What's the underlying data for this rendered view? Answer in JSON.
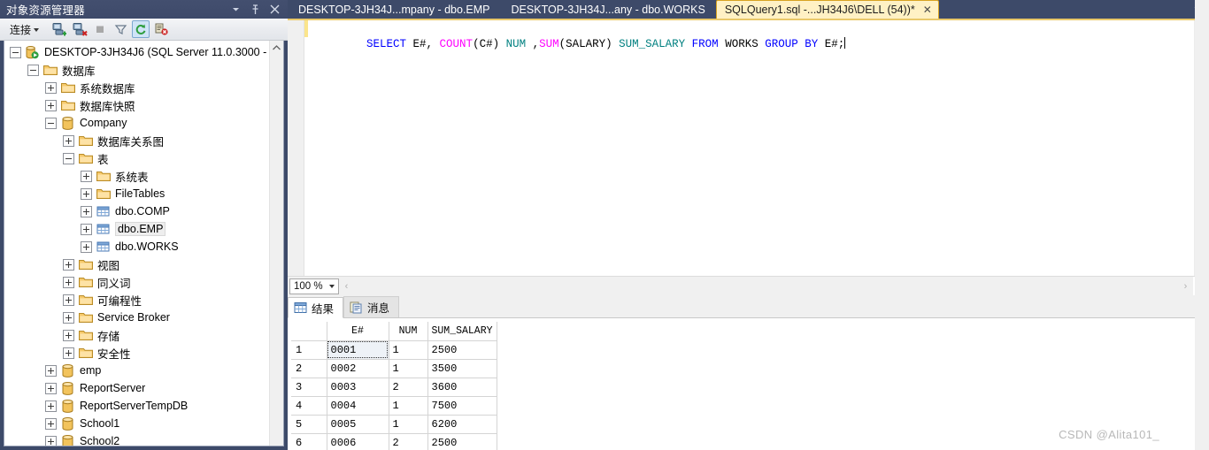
{
  "object_explorer": {
    "title": "对象资源管理器",
    "titlebar_icons": [
      "dropdown-icon",
      "pin-icon",
      "close-icon"
    ],
    "toolbar": {
      "connect_label": "连接",
      "buttons": [
        "connect-icon",
        "disconnect-icon",
        "stop-icon",
        "filter-icon",
        "refresh-icon",
        "script-stop-icon"
      ]
    },
    "tree": [
      {
        "indent": 0,
        "expander": "minus",
        "icon": "server-icon",
        "label": "DESKTOP-3JH34J6 (SQL Server 11.0.3000 -"
      },
      {
        "indent": 1,
        "expander": "minus",
        "icon": "folder-icon",
        "label": "数据库"
      },
      {
        "indent": 2,
        "expander": "plus",
        "icon": "folder-icon",
        "label": "系统数据库"
      },
      {
        "indent": 2,
        "expander": "plus",
        "icon": "folder-icon",
        "label": "数据库快照"
      },
      {
        "indent": 2,
        "expander": "minus",
        "icon": "database-icon",
        "label": "Company"
      },
      {
        "indent": 3,
        "expander": "plus",
        "icon": "folder-icon",
        "label": "数据库关系图"
      },
      {
        "indent": 3,
        "expander": "minus",
        "icon": "folder-icon",
        "label": "表"
      },
      {
        "indent": 4,
        "expander": "plus",
        "icon": "folder-icon",
        "label": "系统表"
      },
      {
        "indent": 4,
        "expander": "plus",
        "icon": "folder-icon",
        "label": "FileTables"
      },
      {
        "indent": 4,
        "expander": "plus",
        "icon": "table-icon",
        "label": "dbo.COMP"
      },
      {
        "indent": 4,
        "expander": "plus",
        "icon": "table-icon",
        "label": "dbo.EMP",
        "selected": true
      },
      {
        "indent": 4,
        "expander": "plus",
        "icon": "table-icon",
        "label": "dbo.WORKS"
      },
      {
        "indent": 3,
        "expander": "plus",
        "icon": "folder-icon",
        "label": "视图"
      },
      {
        "indent": 3,
        "expander": "plus",
        "icon": "folder-icon",
        "label": "同义词"
      },
      {
        "indent": 3,
        "expander": "plus",
        "icon": "folder-icon",
        "label": "可编程性"
      },
      {
        "indent": 3,
        "expander": "plus",
        "icon": "folder-icon",
        "label": "Service Broker"
      },
      {
        "indent": 3,
        "expander": "plus",
        "icon": "folder-icon",
        "label": "存储"
      },
      {
        "indent": 3,
        "expander": "plus",
        "icon": "folder-icon",
        "label": "安全性"
      },
      {
        "indent": 2,
        "expander": "plus",
        "icon": "database-icon",
        "label": "emp"
      },
      {
        "indent": 2,
        "expander": "plus",
        "icon": "database-icon",
        "label": "ReportServer"
      },
      {
        "indent": 2,
        "expander": "plus",
        "icon": "database-icon",
        "label": "ReportServerTempDB"
      },
      {
        "indent": 2,
        "expander": "plus",
        "icon": "database-icon",
        "label": "School1"
      },
      {
        "indent": 2,
        "expander": "plus",
        "icon": "database-icon",
        "label": "School2"
      }
    ]
  },
  "document_tabs": [
    {
      "label": "DESKTOP-3JH34J...mpany - dbo.EMP",
      "active": false
    },
    {
      "label": "DESKTOP-3JH34J...any - dbo.WORKS",
      "active": false
    },
    {
      "label": "SQLQuery1.sql -...JH34J6\\DELL (54))*",
      "active": true,
      "close_label": "✕"
    }
  ],
  "tab_overflow_icon": "chevron-down-icon",
  "editor": {
    "tokens": [
      {
        "text": "SELECT",
        "type": "keyword"
      },
      {
        "text": " E#, ",
        "type": "plain"
      },
      {
        "text": "COUNT",
        "type": "function"
      },
      {
        "text": "(C#) ",
        "type": "plain"
      },
      {
        "text": "NUM",
        "type": "alias"
      },
      {
        "text": " ,",
        "type": "plain"
      },
      {
        "text": "SUM",
        "type": "function"
      },
      {
        "text": "(SALARY) ",
        "type": "plain"
      },
      {
        "text": "SUM_SALARY",
        "type": "alias"
      },
      {
        "text": " ",
        "type": "plain"
      },
      {
        "text": "FROM",
        "type": "keyword"
      },
      {
        "text": " WORKS ",
        "type": "plain"
      },
      {
        "text": "GROUP",
        "type": "keyword"
      },
      {
        "text": " ",
        "type": "plain"
      },
      {
        "text": "BY",
        "type": "keyword"
      },
      {
        "text": " E#;",
        "type": "plain"
      }
    ],
    "full_text": "SELECT E#, COUNT(C#) NUM ,SUM(SALARY) SUM_SALARY FROM WORKS GROUP BY E#;",
    "splitter_icon": "split-horizontal-icon",
    "scroll_up_icon": "chevron-up-icon",
    "scroll_down_icon": "chevron-down-icon"
  },
  "zoombar": {
    "zoom_value": "100 %",
    "left_arrow": "‹",
    "right_arrow": "›"
  },
  "results": {
    "tabs": [
      {
        "label": "结果",
        "icon": "grid-icon",
        "active": true
      },
      {
        "label": "消息",
        "icon": "message-icon",
        "active": false
      }
    ],
    "grid": {
      "columns": [
        "E#",
        "NUM",
        "SUM_SALARY"
      ],
      "rows": [
        {
          "n": "1",
          "cells": [
            "0001",
            "1",
            "2500"
          ]
        },
        {
          "n": "2",
          "cells": [
            "0002",
            "1",
            "3500"
          ]
        },
        {
          "n": "3",
          "cells": [
            "0003",
            "2",
            "3600"
          ]
        },
        {
          "n": "4",
          "cells": [
            "0004",
            "1",
            "7500"
          ]
        },
        {
          "n": "5",
          "cells": [
            "0005",
            "1",
            "6200"
          ]
        },
        {
          "n": "6",
          "cells": [
            "0006",
            "2",
            "2500"
          ]
        }
      ],
      "selected_cell": {
        "row": 0,
        "col": 0
      }
    }
  },
  "watermark": "CSDN @Alita101_",
  "colors": {
    "chrome": "#3d4a69",
    "active_tab_bg": "#fff1c4",
    "active_tab_border": "#d8a322",
    "keyword": "#0000ff",
    "function": "#ff00ff",
    "alias": "#008080",
    "plain": "#000000"
  }
}
